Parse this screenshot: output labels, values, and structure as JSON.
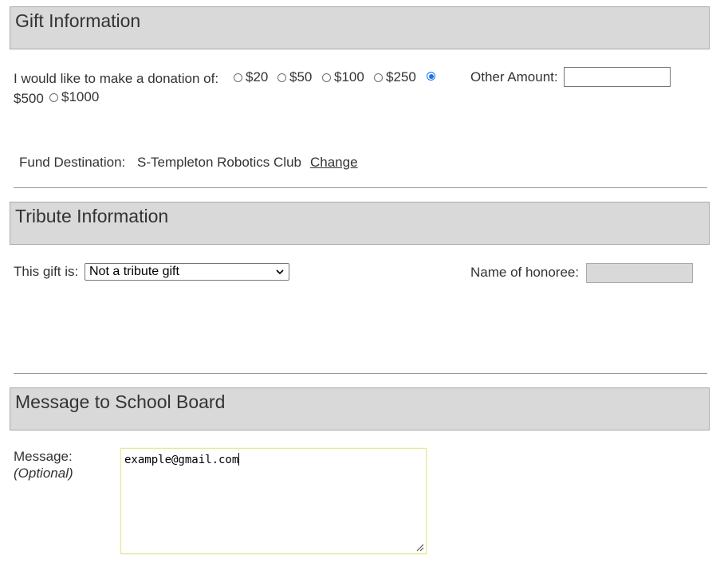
{
  "gift": {
    "header": "Gift Information",
    "donation_prompt": "I would like to make a donation of:",
    "amounts": [
      "$20",
      "$50",
      "$100",
      "$250",
      "$500",
      "$1000"
    ],
    "selected_amount": "$500",
    "other_amount_label": "Other Amount:",
    "other_amount_value": "",
    "fund_label": "Fund Destination:",
    "fund_value": "S-Templeton Robotics Club",
    "change_link": "Change"
  },
  "tribute": {
    "header": "Tribute Information",
    "gift_is_label": "This gift is:",
    "selected_option": "Not a tribute gift",
    "honoree_label": "Name of honoree:",
    "honoree_value": ""
  },
  "message": {
    "header": "Message to School Board",
    "label": "Message:",
    "optional": "(Optional)",
    "value": "example@gmail.com"
  },
  "colors": {
    "header_bg": "#d9d9d9",
    "radio_selected": "#1a73e8",
    "textarea_focus_border": "#e6e69a"
  }
}
